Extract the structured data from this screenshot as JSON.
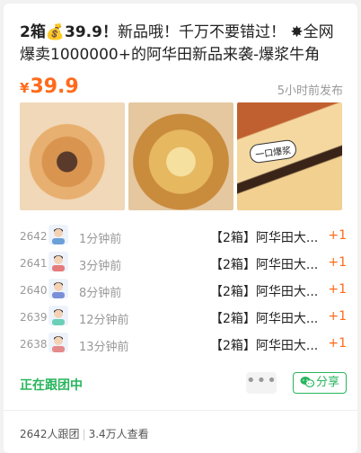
{
  "post": {
    "title_prefix": "2箱💰39.9！",
    "title_rest": "新品哦！千万不要错过！ ✸全网爆卖1000000+的阿华田新品来袭-爆浆牛角包！...",
    "price_symbol": "¥",
    "price_value": "39.9",
    "time_ago": "5小时前发布",
    "photo_tag": "一口爆浆"
  },
  "orders": [
    {
      "num": "2642",
      "ago": "1分钟前",
      "item": "【2箱】阿华田大...",
      "qty": "+1",
      "avatar_color": "#6aa0d8"
    },
    {
      "num": "2641",
      "ago": "3分钟前",
      "item": "【2箱】阿华田大...",
      "qty": "+1",
      "avatar_color": "#e57b7b"
    },
    {
      "num": "2640",
      "ago": "8分钟前",
      "item": "【2箱】阿华田大...",
      "qty": "+1",
      "avatar_color": "#7b8fd8"
    },
    {
      "num": "2639",
      "ago": "12分钟前",
      "item": "【2箱】阿华田大...",
      "qty": "+1",
      "avatar_color": "#6ccfb8"
    },
    {
      "num": "2638",
      "ago": "13分钟前",
      "item": "【2箱】阿华田大...",
      "qty": "+1",
      "avatar_color": "#e58a8a"
    }
  ],
  "actions": {
    "following_label": "正在跟团中",
    "more_label": "•••",
    "share_label": "分享"
  },
  "footer": {
    "followers": "2642人跟团",
    "views": "3.4万人查看"
  },
  "colors": {
    "accent_orange": "#ff6a1a",
    "accent_green": "#27b55c"
  }
}
